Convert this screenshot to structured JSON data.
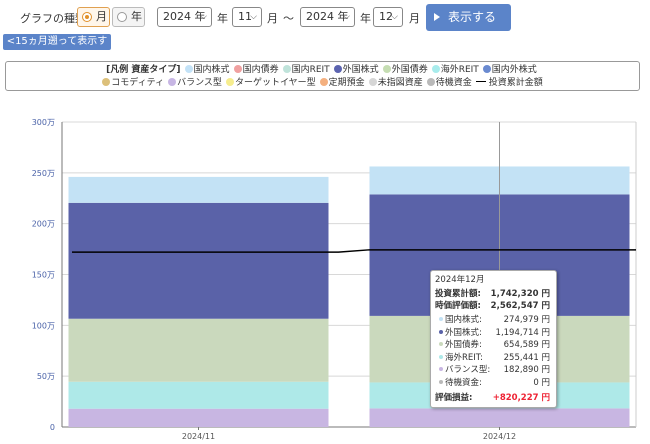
{
  "controls": {
    "graph_type_label": "グラフの種類:",
    "radio_month": "月",
    "radio_year": "年",
    "start_year": "2024 年",
    "year_unit_1": "年",
    "start_month": "11",
    "month_unit_1": "月",
    "range_sep": "〜",
    "end_year": "2024 年",
    "year_unit_2": "年",
    "end_month": "12",
    "month_unit_2": "月",
    "show_label": "表示する",
    "back_label": "<15ヵ月遡って表示する"
  },
  "legend": {
    "title": "[凡例 資産タイプ]",
    "items": [
      {
        "label": "国内株式",
        "color": "#c3e2f7"
      },
      {
        "label": "国内債券",
        "color": "#f0a0a0"
      },
      {
        "label": "国内REIT",
        "color": "#bfe3da"
      },
      {
        "label": "外国株式",
        "color": "#5c64b0"
      },
      {
        "label": "外国債券",
        "color": "#c5ddb2"
      },
      {
        "label": "海外REIT",
        "color": "#a8ecec"
      },
      {
        "label": "国内外株式",
        "color": "#6a8ad0"
      },
      {
        "label": "コモディティ",
        "color": "#dcc07a"
      },
      {
        "label": "バランス型",
        "color": "#c7b6e4"
      },
      {
        "label": "ターゲットイヤー型",
        "color": "#f6ed8e"
      },
      {
        "label": "定期預金",
        "color": "#f4b07f"
      },
      {
        "label": "未指図資産",
        "color": "#d6d6d6"
      },
      {
        "label": "待機資金",
        "color": "#b9b9b9"
      }
    ],
    "line_label": "投資累計金額"
  },
  "chart_data": {
    "type": "bar",
    "categories": [
      "2024/11",
      "2024/12"
    ],
    "y_ticks": [
      "0",
      "50万",
      "100万",
      "150万",
      "200万",
      "250万",
      "300万"
    ],
    "ylim": [
      0,
      3000000
    ],
    "grid": true,
    "series": [
      {
        "name": "バランス型",
        "color": "#c8b6e2",
        "values": [
          180000,
          182890
        ]
      },
      {
        "name": "海外REIT",
        "color": "#aee9e8",
        "values": [
          265000,
          255441
        ]
      },
      {
        "name": "外国債券",
        "color": "#cad9bd",
        "values": [
          620000,
          654589
        ]
      },
      {
        "name": "外国株式",
        "color": "#5a62a8",
        "values": [
          1140000,
          1194714
        ]
      },
      {
        "name": "国内株式",
        "color": "#c3e2f5",
        "values": [
          255000,
          274979
        ]
      }
    ],
    "line": {
      "name": "投資累計金額",
      "values": [
        1720000,
        1742320
      ]
    }
  },
  "tooltip": {
    "title": "2024年12月",
    "cumulative_label": "投資累計額",
    "cumulative_value": "1,742,320 円",
    "market_label": "時価評価額",
    "market_value": "2,562,547 円",
    "rows": [
      {
        "label": "国内株式",
        "value": "274,979 円",
        "color": "#c3e2f5"
      },
      {
        "label": "外国株式",
        "value": "1,194,714 円",
        "color": "#5a62a8"
      },
      {
        "label": "外国債券",
        "value": "654,589 円",
        "color": "#cad9bd"
      },
      {
        "label": "海外REIT",
        "value": "255,441 円",
        "color": "#aee9e8"
      },
      {
        "label": "バランス型",
        "value": "182,890 円",
        "color": "#c8b6e2"
      },
      {
        "label": "待機資金",
        "value": "0 円",
        "color": "#b9b9b9"
      }
    ],
    "gain_label": "評価損益",
    "gain_value": "+820,227 円"
  }
}
